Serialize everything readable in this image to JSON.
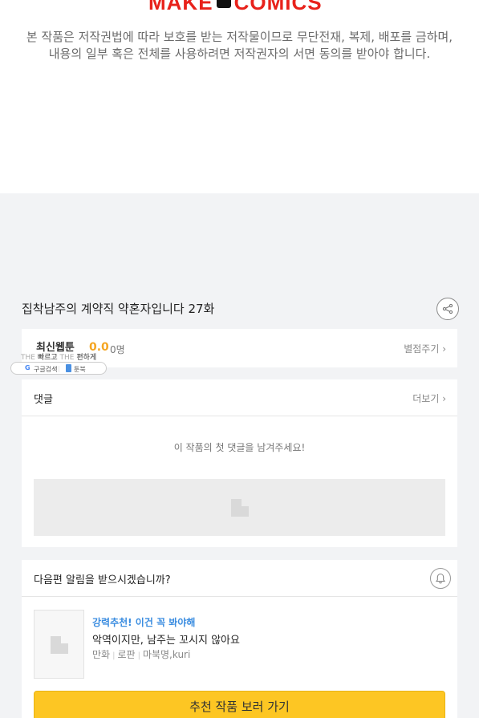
{
  "header": {
    "logo_text_left": "MAKE",
    "logo_text_right": "COMICS",
    "copyright_line1": "본 작품은 저작권법에 따라 보호를 받는 저작물이므로 무단전재, 복제, 배포를 금하며,",
    "copyright_line2": "내용의 일부 혹은 전체를 사용하려면 저작권자의 서면 동의를 받아야 합니다."
  },
  "episode": {
    "title": "집착남주의 계약직 약혼자입니다 27화",
    "share_icon": "share-icon"
  },
  "rating": {
    "label": "최신웹툰",
    "score": "0.0",
    "count": "0명",
    "action_label": "별점주기 ›"
  },
  "promo": {
    "the1": "THE",
    "fast": "빠르고",
    "the2": "THE",
    "easy": "편하게",
    "google_glyph": "G",
    "google_label": "구글검색",
    "bookmark_label": "툰북"
  },
  "comments": {
    "label": "댓글",
    "more_label": "더보기 ›",
    "empty_message": "이 작품의 첫 댓글을 남겨주세요!"
  },
  "notify": {
    "question": "다음편 알림을 받으시겠습니까?",
    "bell_icon": "bell-icon"
  },
  "recommend": {
    "tag": "강력추천! 이건 꼭 봐야해",
    "title": "악역이지만, 남주는 꼬시지 않아요",
    "meta": [
      "만화",
      "로판",
      "마북명,kuri"
    ],
    "button_label": "추천 작품 보러 가기"
  },
  "colors": {
    "logo_red": "#e8221b",
    "score_orange": "#f5a623",
    "tag_blue": "#3b8de0",
    "button_yellow": "#fdc623"
  }
}
